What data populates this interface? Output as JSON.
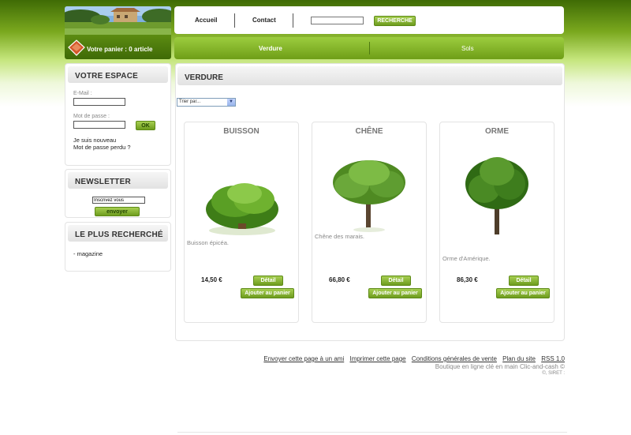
{
  "header": {
    "cart_label": "Votre panier : 0 article",
    "nav": [
      "Accueil",
      "Contact"
    ],
    "search": {
      "value": "",
      "button": "RECHERCHE"
    },
    "categories": [
      "Verdure",
      "Sols"
    ]
  },
  "sidebar": {
    "espace": {
      "title": "VOTRE ESPACE",
      "email_label": "E-Mail :",
      "password_label": "Mot de passe :",
      "ok_button": "OK",
      "new_user": "Je suis nouveau",
      "lost_password": "Mot de passe perdu ?"
    },
    "newsletter": {
      "title": "NEWSLETTER",
      "input_value": "Inscrivez vous",
      "button": "envoyer"
    },
    "popular": {
      "title": "LE PLUS RECHERCHÉ",
      "items": [
        "- magazine"
      ]
    }
  },
  "main": {
    "title": "VERDURE",
    "sort": {
      "selected": "Trier par..."
    },
    "products": [
      {
        "name": "BUISSON",
        "description": "Buisson épicéa.",
        "price": "14,50 €",
        "detail": "Détail",
        "add": "Ajouter au panier"
      },
      {
        "name": "CHÊNE",
        "description": "Chêne des marais.",
        "price": "66,80 €",
        "detail": "Détail",
        "add": "Ajouter au panier"
      },
      {
        "name": "ORME",
        "description": "Orme d'Amérique.",
        "price": "86,30 €",
        "detail": "Détail",
        "add": "Ajouter au panier"
      }
    ]
  },
  "footer": {
    "links": [
      "Envoyer cette page à un ami",
      "Imprimer cette page",
      "Conditions générales de vente",
      "Plan du site",
      "RSS 1.0"
    ],
    "tagline": "Boutique en ligne clé en main Clic-and-cash ©",
    "siret": "©, SIRET :"
  },
  "colors": {
    "accent": "#7aa81e",
    "dark_green": "#3f6a06"
  }
}
